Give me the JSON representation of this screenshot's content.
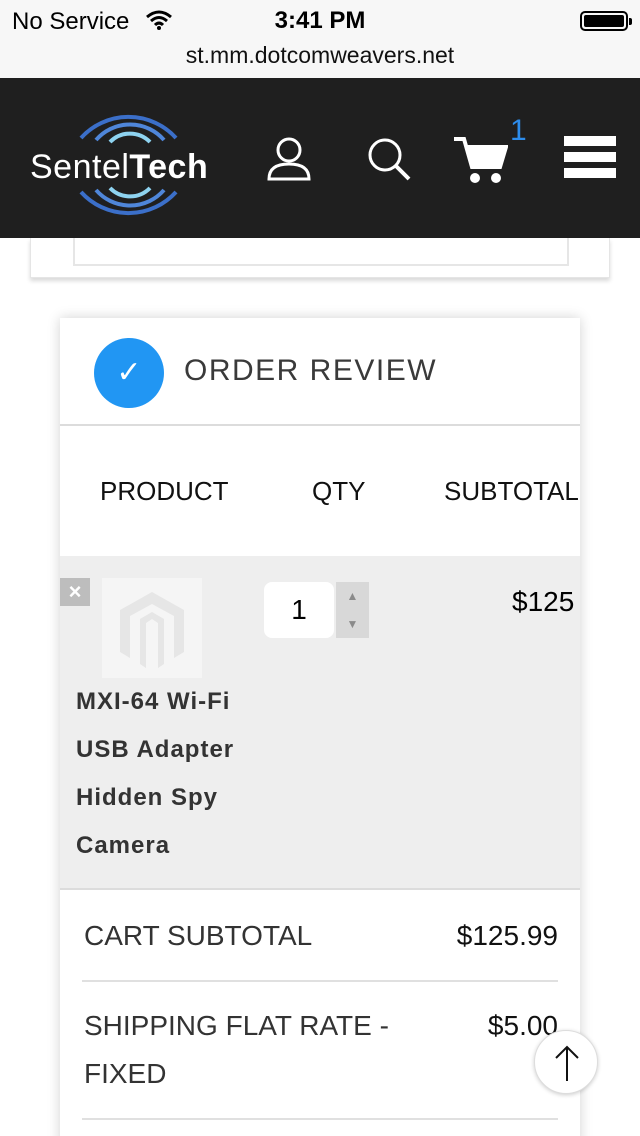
{
  "status_bar": {
    "carrier": "No Service",
    "time": "3:41 PM"
  },
  "browser": {
    "url": "st.mm.dotcomweavers.net"
  },
  "header": {
    "logo_text_1": "Sentel",
    "logo_text_2": "Tech",
    "cart_count": "1",
    "icons": [
      "user-icon",
      "search-icon",
      "cart-icon",
      "menu-icon"
    ]
  },
  "order_review": {
    "check_mark": "✓",
    "title": "ORDER REVIEW",
    "columns": {
      "product": "PRODUCT",
      "qty": "QTY",
      "subtotal": "SUBTOTAL"
    },
    "item": {
      "remove": "×",
      "name": "MXI-64 Wi-Fi USB Adapter Hidden Spy Camera",
      "qty": "1",
      "price": "$125"
    },
    "totals": [
      {
        "label": "CART SUBTOTAL",
        "value": "$125.99"
      },
      {
        "label": "SHIPPING FLAT RATE - FIXED",
        "value": "$5.00"
      }
    ]
  },
  "colors": {
    "accent": "#2196f3",
    "header_bg": "#1f1f1f",
    "cart_badge": "#2d8ceb"
  }
}
